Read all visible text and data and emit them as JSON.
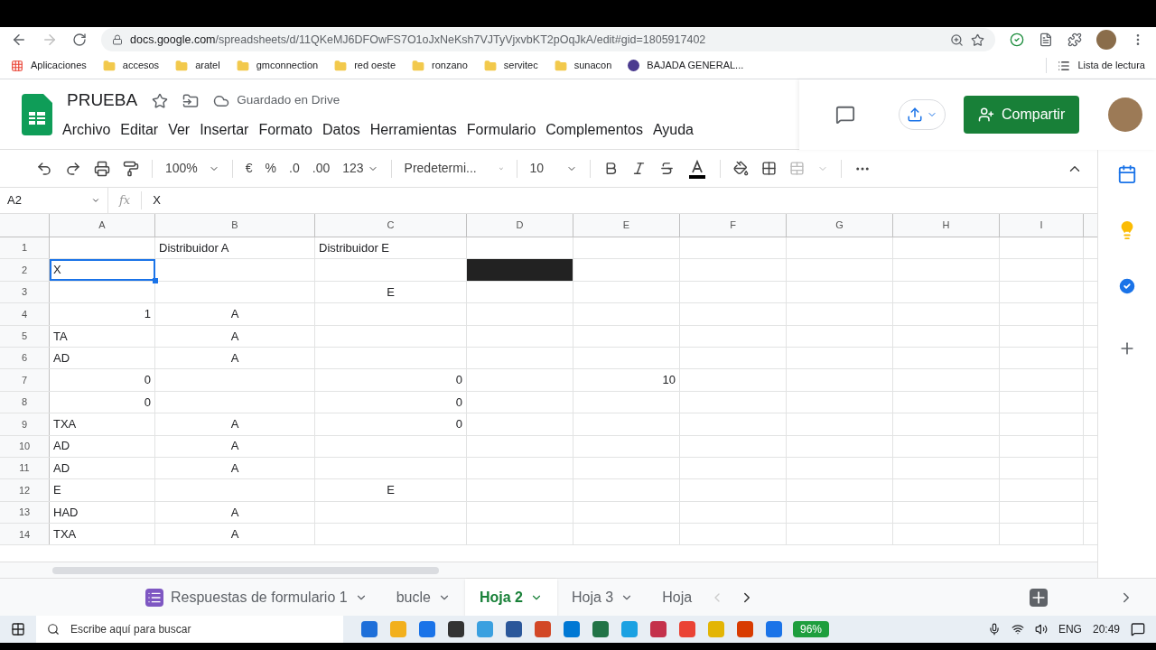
{
  "browser": {
    "url_host": "docs.google.com",
    "url_path": "/spreadsheets/d/11QKeMJ6DFOwFS7O1oJxNeKsh7VJTyVjxvbKT2pOqJkA/edit#gid=1805917402",
    "bookmarks": [
      {
        "label": "Aplicaciones",
        "kind": "apps"
      },
      {
        "label": "accesos",
        "kind": "folder"
      },
      {
        "label": "aratel",
        "kind": "folder"
      },
      {
        "label": "gmconnection",
        "kind": "folder"
      },
      {
        "label": "red oeste",
        "kind": "folder"
      },
      {
        "label": "ronzano",
        "kind": "folder"
      },
      {
        "label": "servitec",
        "kind": "folder"
      },
      {
        "label": "sunacon",
        "kind": "folder"
      },
      {
        "label": "BAJADA GENERAL...",
        "kind": "site"
      }
    ],
    "reading_list": "Lista de lectura"
  },
  "doc": {
    "title": "PRUEBA",
    "save_status": "Guardado en Drive",
    "share": "Compartir",
    "menu": [
      "Archivo",
      "Editar",
      "Ver",
      "Insertar",
      "Formato",
      "Datos",
      "Herramientas",
      "Formulario",
      "Complementos",
      "Ayuda"
    ]
  },
  "toolbar": {
    "zoom": "100%",
    "currency": "€",
    "percent": "%",
    "dec_less": ".0",
    "dec_more": ".00",
    "format": "123",
    "font": "Predetermi...",
    "size": "10"
  },
  "formula_bar": {
    "cell": "A2",
    "function_label": "fx",
    "value": "X"
  },
  "grid": {
    "columns": [
      "A",
      "B",
      "C",
      "D",
      "E",
      "F",
      "G",
      "H",
      "I"
    ],
    "rows": [
      {
        "label": "1",
        "B": {
          "text": "Distribuidor A",
          "kind": "text",
          "selected": false
        },
        "C": {
          "text": "Distribuidor E",
          "kind": "text",
          "selected": false
        }
      },
      {
        "label": "2",
        "A": {
          "text": "X",
          "kind": "text",
          "selected": true
        },
        "D": {
          "filled": true,
          "selected": false
        }
      },
      {
        "label": "3",
        "C": {
          "text": "E",
          "kind": "centered",
          "selected": false
        }
      },
      {
        "label": "4",
        "A": {
          "text": "1",
          "kind": "number",
          "selected": false
        },
        "B": {
          "text": "A",
          "kind": "centered",
          "selected": false
        }
      },
      {
        "label": "5",
        "A": {
          "text": "TA",
          "kind": "text",
          "selected": false
        },
        "B": {
          "text": "A",
          "kind": "centered",
          "selected": false
        }
      },
      {
        "label": "6",
        "A": {
          "text": "AD",
          "kind": "text",
          "selected": false
        },
        "B": {
          "text": "A",
          "kind": "centered",
          "selected": false
        }
      },
      {
        "label": "7",
        "A": {
          "text": "0",
          "kind": "number",
          "selected": false
        },
        "C": {
          "text": "0",
          "kind": "number",
          "selected": false
        },
        "E": {
          "text": "10",
          "kind": "number",
          "selected": false
        }
      },
      {
        "label": "8",
        "A": {
          "text": "0",
          "kind": "number",
          "selected": false
        },
        "C": {
          "text": "0",
          "kind": "number",
          "selected": false
        }
      },
      {
        "label": "9",
        "A": {
          "text": "TXA",
          "kind": "text",
          "selected": false
        },
        "B": {
          "text": "A",
          "kind": "centered",
          "selected": false
        },
        "C": {
          "text": "0",
          "kind": "number",
          "selected": false
        }
      },
      {
        "label": "10",
        "A": {
          "text": "AD",
          "kind": "text",
          "selected": false
        },
        "B": {
          "text": "A",
          "kind": "centered",
          "selected": false
        }
      },
      {
        "label": "11",
        "A": {
          "text": "AD",
          "kind": "text",
          "selected": false
        },
        "B": {
          "text": "A",
          "kind": "centered",
          "selected": false
        }
      },
      {
        "label": "12",
        "A": {
          "text": "E",
          "kind": "text",
          "selected": false
        },
        "C": {
          "text": "E",
          "kind": "centered",
          "selected": false
        }
      },
      {
        "label": "13",
        "A": {
          "text": "HAD",
          "kind": "text",
          "selected": false
        },
        "B": {
          "text": "A",
          "kind": "centered",
          "selected": false
        }
      },
      {
        "label": "14",
        "A": {
          "text": "TXA",
          "kind": "text",
          "selected": false
        },
        "B": {
          "text": "A",
          "kind": "centered",
          "selected": false
        }
      }
    ]
  },
  "sheet_tabs": [
    {
      "label": "Respuestas de formulario 1",
      "kind": "form",
      "selected": false
    },
    {
      "label": "bucle",
      "kind": "sheet",
      "selected": false
    },
    {
      "label": "Hoja 2",
      "kind": "sheet",
      "selected": true
    },
    {
      "label": "Hoja 3",
      "kind": "sheet",
      "selected": false
    },
    {
      "label": "Hoja",
      "kind": "cut",
      "selected": false
    }
  ],
  "taskbar": {
    "search_placeholder": "Escribe aquí para buscar",
    "battery": "96%",
    "language": "ENG",
    "time": "20:49"
  }
}
